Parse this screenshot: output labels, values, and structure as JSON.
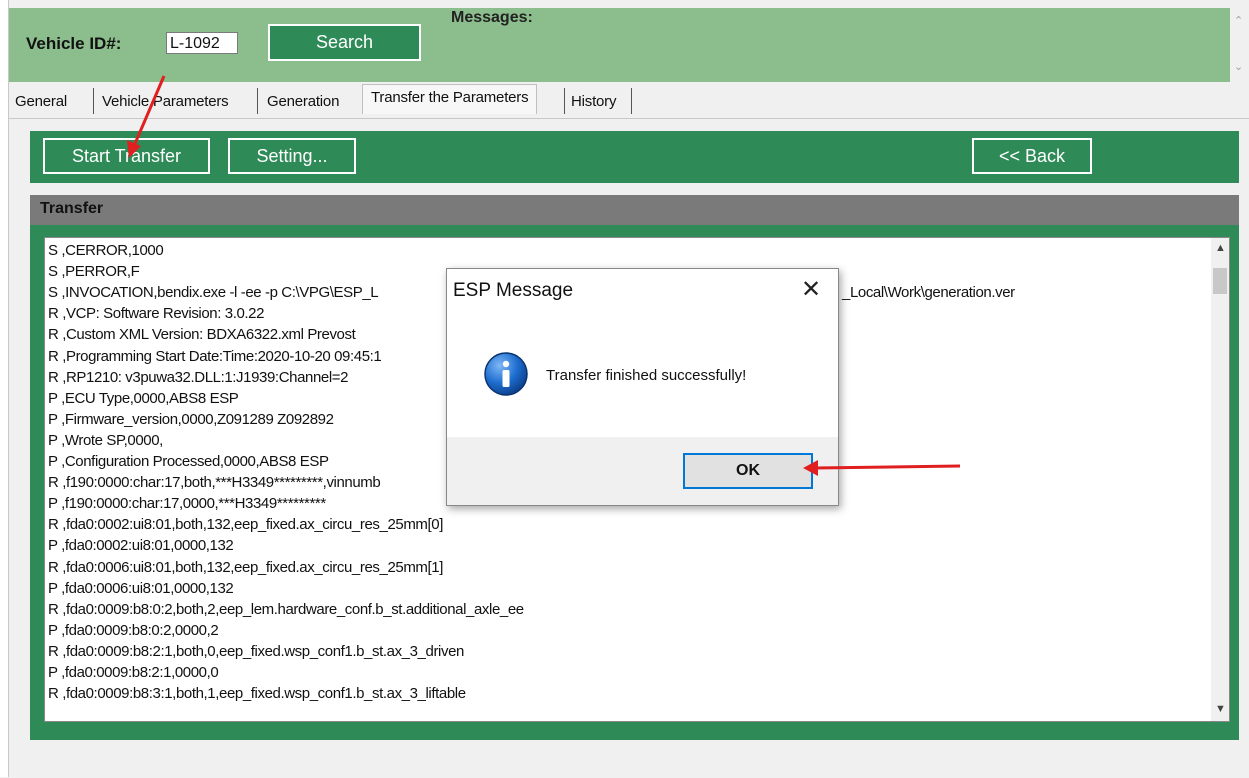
{
  "header": {
    "vehicle_id_label": "Vehicle ID#:",
    "vehicle_id_value": "L-1092",
    "search_label": "Search",
    "messages_label": "Messages:"
  },
  "tabs": [
    {
      "label": "General"
    },
    {
      "label": "Vehicle Parameters"
    },
    {
      "label": "Generation"
    },
    {
      "label": "Transfer the Parameters",
      "active": true
    },
    {
      "label": "History"
    }
  ],
  "toolbar": {
    "start_transfer_label": "Start Transfer",
    "setting_label": "Setting...",
    "back_label": "<< Back"
  },
  "transfer": {
    "title": "Transfer",
    "lines": [
      "S ,CERROR,1000",
      "S ,PERROR,F",
      "S ,INVOCATION,bendix.exe -l -ee -p C:\\VPG\\ESP_L",
      "R ,VCP: Software Revision: 3.0.22",
      "R ,Custom XML Version: BDXA6322.xml Prevost",
      "R ,Programming Start Date:Time:2020-10-20 09:45:1",
      "R ,RP1210: v3puwa32.DLL:1:J1939:Channel=2",
      "P ,ECU Type,0000,ABS8 ESP",
      "P ,Firmware_version,0000,Z091289  Z092892",
      "P ,Wrote SP,0000,",
      "P ,Configuration Processed,0000,ABS8 ESP",
      "R ,f190:0000:char:17,both,***H3349*********,vinnumb",
      "P ,f190:0000:char:17,0000,***H3349*********",
      "R ,fda0:0002:ui8:01,both,132,eep_fixed.ax_circu_res_25mm[0]",
      "P ,fda0:0002:ui8:01,0000,132",
      "R ,fda0:0006:ui8:01,both,132,eep_fixed.ax_circu_res_25mm[1]",
      "P ,fda0:0006:ui8:01,0000,132",
      "R ,fda0:0009:b8:0:2,both,2,eep_lem.hardware_conf.b_st.additional_axle_ee",
      "P ,fda0:0009:b8:0:2,0000,2",
      "R ,fda0:0009:b8:2:1,both,0,eep_fixed.wsp_conf1.b_st.ax_3_driven",
      "P ,fda0:0009:b8:2:1,0000,0",
      "R ,fda0:0009:b8:3:1,both,1,eep_fixed.wsp_conf1.b_st.ax_3_liftable"
    ],
    "overflow_text": "_Local\\Work\\generation.ver"
  },
  "dialog": {
    "title": "ESP Message",
    "message": "Transfer finished successfully!",
    "ok_label": "OK",
    "icon": "info-icon"
  },
  "colors": {
    "header_green": "#8cbd8c",
    "toolbar_green": "#2e8b57",
    "arrow_red": "#e02020"
  }
}
